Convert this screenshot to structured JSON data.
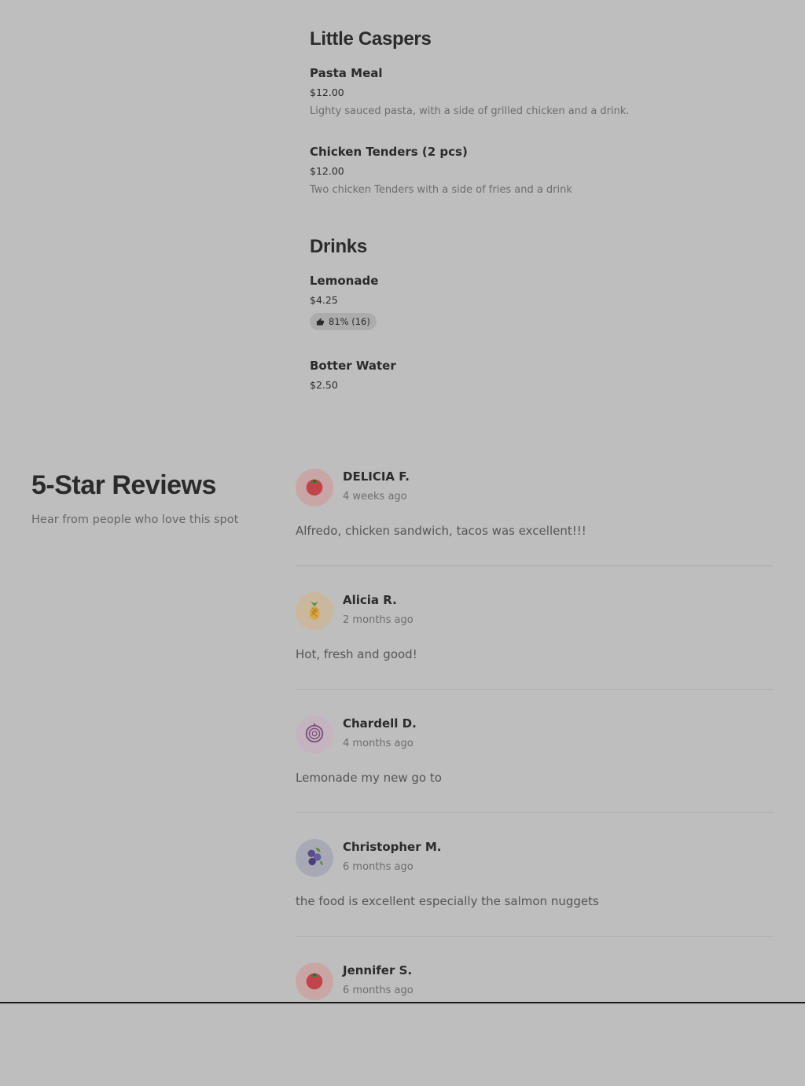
{
  "menu": {
    "sections": [
      {
        "title": "Little Caspers",
        "items": [
          {
            "name": "Pasta Meal",
            "price": "$12.00",
            "description": "Lighty sauced pasta, with a side of grilled chicken and a drink."
          },
          {
            "name": "Chicken Tenders (2 pcs)",
            "price": "$12.00",
            "description": "Two chicken Tenders with a side of fries and a drink"
          }
        ]
      },
      {
        "title": "Drinks",
        "items": [
          {
            "name": "Lemonade",
            "price": "$4.25",
            "rating": "81% (16)"
          },
          {
            "name": "Botter Water",
            "price": "$2.50"
          }
        ]
      }
    ]
  },
  "reviews": {
    "title": "5-Star Reviews",
    "subtitle": "Hear from people who love this spot",
    "items": [
      {
        "name": "DELICIA F.",
        "time": "4 weeks ago",
        "text": "Alfredo, chicken sandwich, tacos was excellent!!!",
        "avatar_icon": "tomato-icon"
      },
      {
        "name": "Alicia R.",
        "time": "2 months ago",
        "text": "Hot, fresh and good!",
        "avatar_icon": "pineapple-icon"
      },
      {
        "name": "Chardell D.",
        "time": "4 months ago",
        "text": "Lemonade my new go to",
        "avatar_icon": "onion-icon"
      },
      {
        "name": "Christopher M.",
        "time": "6 months ago",
        "text": "the food is excellent especially the salmon nuggets",
        "avatar_icon": "blueberries-icon"
      },
      {
        "name": "Jennifer S.",
        "time": "6 months ago",
        "text": "",
        "avatar_icon": "tomato-icon"
      }
    ]
  },
  "colors": {
    "background": "#bebebe",
    "text": "#2b2b2b",
    "muted_text": "#6d6d6d",
    "pill": "#acacac"
  }
}
